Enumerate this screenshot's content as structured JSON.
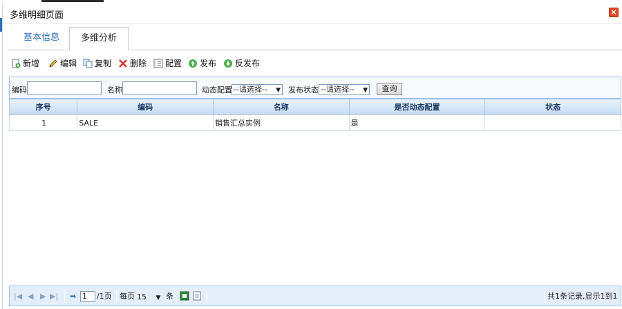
{
  "window": {
    "title": "多维明细页面",
    "close_icon": "close-icon"
  },
  "tabs": [
    {
      "label": "基本信息",
      "active": false
    },
    {
      "label": "多维分析",
      "active": true
    }
  ],
  "toolbar": {
    "add": "新增",
    "edit": "编辑",
    "copy": "复制",
    "delete": "删除",
    "config": "配置",
    "publish": "发布",
    "unpublish": "反发布"
  },
  "filter": {
    "code_label": "编码",
    "code_value": "",
    "name_label": "名称",
    "name_value": "",
    "dynamic_label": "动态配置",
    "dynamic_value": "--请选择--",
    "status_label": "发布状态",
    "status_value": "--请选择--",
    "query_label": "查询"
  },
  "grid": {
    "columns": [
      "序号",
      "编码",
      "名称",
      "是否动态配置",
      "状态"
    ],
    "rows": [
      [
        "1",
        "SALE",
        "销售汇总实例",
        "是",
        ""
      ]
    ]
  },
  "pager": {
    "page_value": "1",
    "total_pages": "/1页",
    "per_page_label": "每页",
    "per_page_value": "15",
    "per_page_unit": "条",
    "summary": "共1条记录,显示1到1"
  },
  "colors": {
    "accent": "#2a6ab3",
    "header_bg": "#c6dcf3",
    "close": "#e04a2a"
  }
}
